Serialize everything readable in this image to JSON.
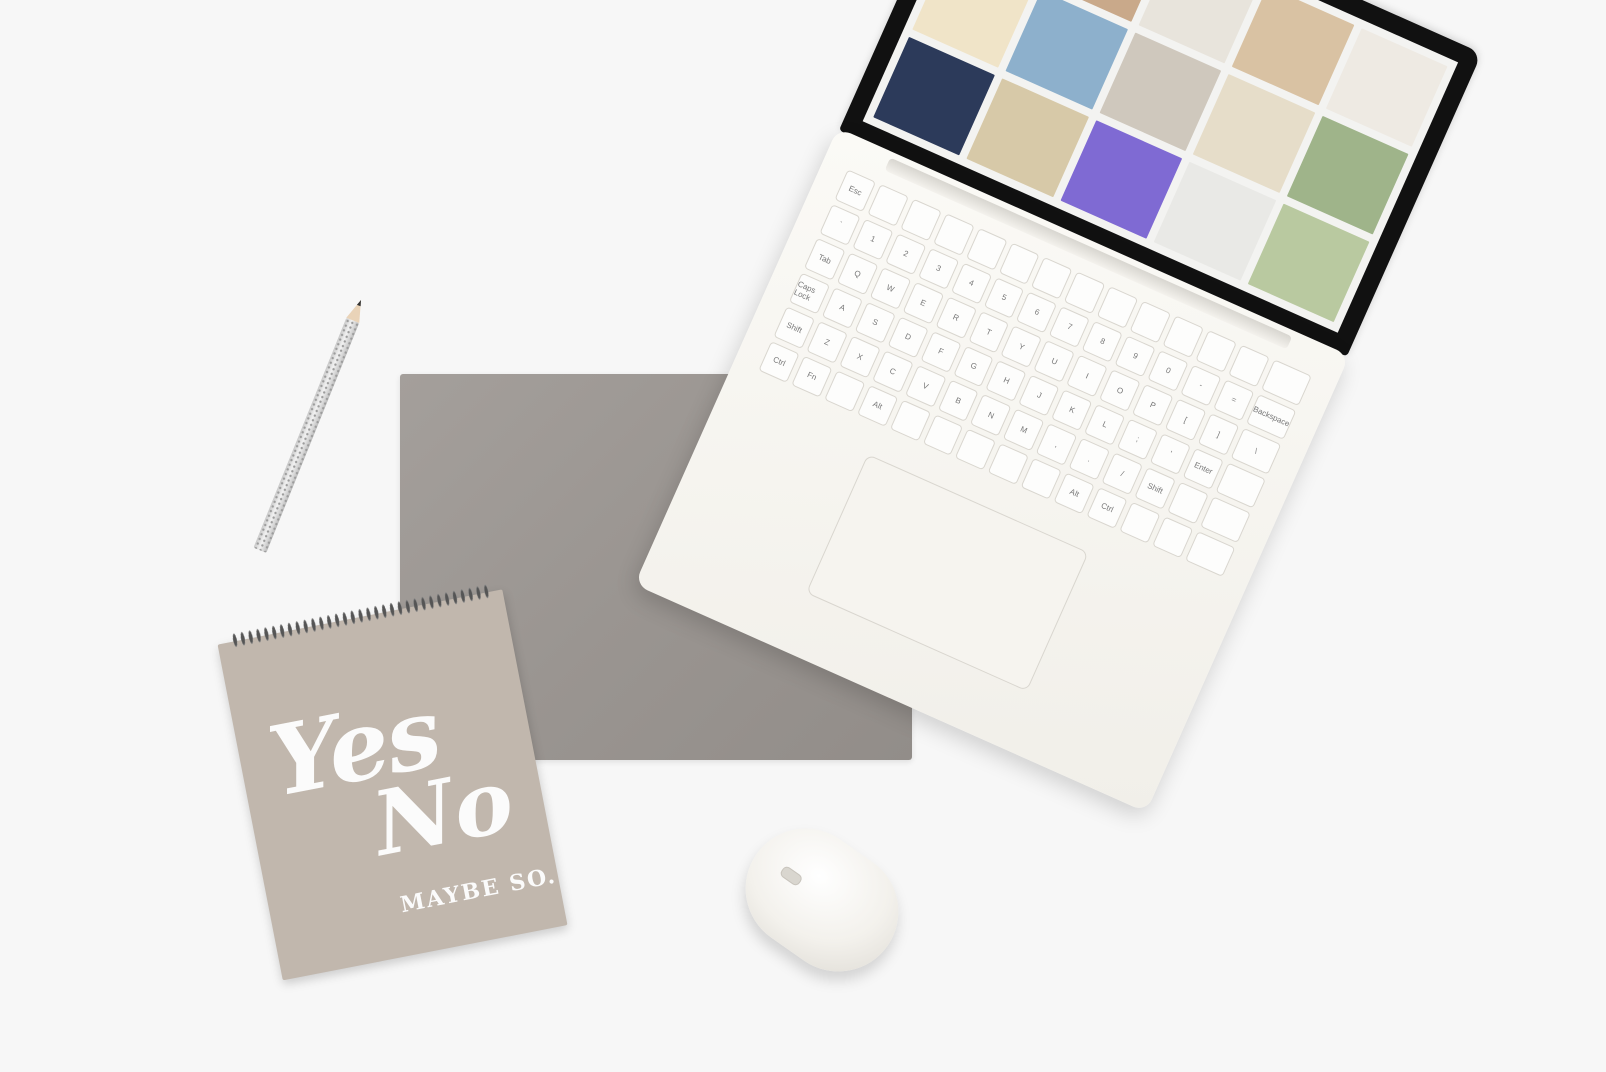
{
  "scene": {
    "background_color": "#f7f7f7",
    "objects": [
      "gray-sleeve",
      "pencil",
      "notebook",
      "laptop",
      "mouse"
    ]
  },
  "notebook": {
    "title_yes": "Yes",
    "title_no": "No",
    "subtitle": "MAYBE SO.",
    "cover_color": "#c1b7ad"
  },
  "laptop": {
    "body_color": "#f1efe9",
    "keyboard_keys": [
      "Esc",
      "",
      "",
      "",
      "",
      "",
      "",
      "",
      "",
      "",
      "",
      "",
      "",
      "",
      "`",
      "1",
      "2",
      "3",
      "4",
      "5",
      "6",
      "7",
      "8",
      "9",
      "0",
      "-",
      "=",
      "Backspace",
      "Tab",
      "Q",
      "W",
      "E",
      "R",
      "T",
      "Y",
      "U",
      "I",
      "O",
      "P",
      "[",
      "]",
      "\\",
      "Caps Lock",
      "A",
      "S",
      "D",
      "F",
      "G",
      "H",
      "J",
      "K",
      "L",
      ";",
      "'",
      "Enter",
      "",
      "Shift",
      "Z",
      "X",
      "C",
      "V",
      "B",
      "N",
      "M",
      ",",
      ".",
      "/",
      "Shift",
      "",
      "",
      "Ctrl",
      "Fn",
      "",
      "Alt",
      "",
      "",
      "",
      "",
      "",
      "Alt",
      "Ctrl",
      "",
      "",
      ""
    ],
    "screen_tiles": [
      {
        "color": "#e7dfd7"
      },
      {
        "color": "#c9a98a"
      },
      {
        "color": "#e8e4dc"
      },
      {
        "color": "#d9c2a3"
      },
      {
        "color": "#eeeae3"
      },
      {
        "color": "#f0e4c8"
      },
      {
        "color": "#8db0cc"
      },
      {
        "color": "#cfc8bd"
      },
      {
        "color": "#e6ddc9"
      },
      {
        "color": "#9fb48a"
      },
      {
        "color": "#2c3a5a"
      },
      {
        "color": "#d7c9a8"
      },
      {
        "color": "#7f6ad3"
      },
      {
        "color": "#e9e9e6"
      },
      {
        "color": "#b9c9a0"
      }
    ]
  },
  "mouse": {
    "color": "#f3f1ec"
  }
}
